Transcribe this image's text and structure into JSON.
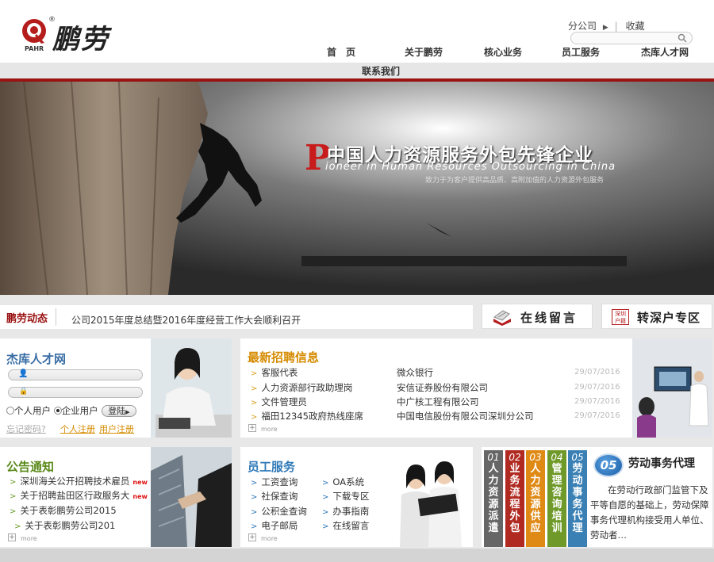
{
  "header": {
    "brand": "鹏劳",
    "brand_sub": "PAHR",
    "reg_mark": "®",
    "top_links": [
      "分公司",
      "收藏"
    ],
    "search_placeholder": ""
  },
  "nav": {
    "items": [
      "首　页",
      "关于鹏劳",
      "核心业务",
      "员工服务",
      "杰库人才网"
    ],
    "second_row": "联系我们"
  },
  "banner": {
    "p_letter": "P",
    "title": "中国人力资源服务外包先锋企业",
    "english": "ioneer in Human Resources Outsourcing in China",
    "slogan": "致力于为客户提供高品质、高附加值的人力资源外包服务"
  },
  "news": {
    "label": "鹏劳动态",
    "item": "公司2015年度总结暨2016年度经营工作大会顺利召开",
    "btn_message": "在线留言",
    "btn_transfer": "转深户专区",
    "badge_text": "深圳户籍"
  },
  "talent": {
    "title": "杰库人才网",
    "radio_personal": "个人用户",
    "radio_company": "企业用户",
    "login": "登陆",
    "forgot": "忘记密码?",
    "reg_personal": "个人注册",
    "reg_company": "用户注册",
    "colors": {
      "title": "#3a6ea5",
      "link": "#d58b00"
    }
  },
  "recruit": {
    "title": "最新招聘信息",
    "rows": [
      {
        "job": "客服代表",
        "company": "微众银行",
        "date": "29/07/2016"
      },
      {
        "job": "人力资源部行政助理岗",
        "company": "安信证券股份有限公司",
        "date": "29/07/2016"
      },
      {
        "job": "文件管理员",
        "company": "中广核工程有限公司",
        "date": "29/07/2016"
      },
      {
        "job": "福田12345政府热线座席",
        "company": "中国电信股份有限公司深圳分公司",
        "date": "29/07/2016"
      }
    ],
    "more": "more",
    "color": "#d58b00"
  },
  "notice": {
    "title": "公告通知",
    "items": [
      {
        "text": "深圳海关公开招聘技术雇员",
        "badge": "new"
      },
      {
        "text": "关于招聘盐田区行政服务大",
        "badge": "new"
      },
      {
        "text": "关于表彰鹏劳公司2015",
        "badge": ""
      },
      {
        "text": "关于表彰鹏劳公司201",
        "badge": ""
      }
    ],
    "more": "more",
    "color": "#5a8a1a"
  },
  "employee": {
    "title": "员工服务",
    "col1": [
      "工资查询",
      "社保查询",
      "公积金查询",
      "电子邮局"
    ],
    "col2": [
      "OA系统",
      "下载专区",
      "办事指南",
      "在线留言"
    ],
    "more": "more",
    "color": "#2f79b8"
  },
  "business": {
    "tabs": [
      {
        "num": "01",
        "label": "人力资源派遣",
        "color": "#666666"
      },
      {
        "num": "02",
        "label": "业务流程外包",
        "color": "#b12a22"
      },
      {
        "num": "03",
        "label": "人力资源供应",
        "color": "#e08a16"
      },
      {
        "num": "04",
        "label": "管理咨询培训",
        "color": "#6f9a2a"
      },
      {
        "num": "05",
        "label": "劳动事务代理",
        "color": "#3a80b4"
      }
    ],
    "active_num": "05",
    "active_title": "劳动事务代理",
    "active_desc": "在劳动行政部门监管下及平等自愿的基础上，劳动保障事务代理机构接受用人单位、劳动者…"
  }
}
